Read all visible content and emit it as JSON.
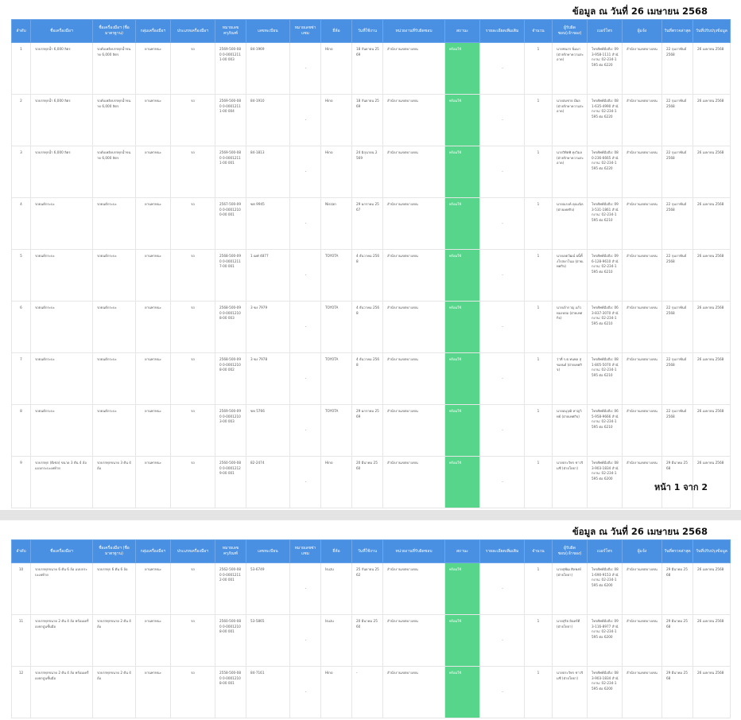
{
  "as_of": "ข้อมูล ณ วันที่ 26 เมษายน 2568",
  "page_indicator": "หน้า 1 จาก 2",
  "colors": {
    "header": "#4a90e2",
    "status_bg": "#57d58a",
    "page_gap": "#e4e4e4"
  },
  "columns": [
    "ลำดับ",
    "ชื่อเครื่องมือฯ",
    "ชื่อเครื่องมือฯ (ชื่อมาตรฐาน)",
    "กลุ่มเครื่องมือฯ",
    "ประเภทเครื่องมือฯ",
    "หมายเลขครุภัณฑ์",
    "เลขทะเบียน",
    "หมายเลขซ่าแซม",
    "ยี่ห้อ",
    "วันที่ใช้งาน",
    "หน่วยงานที่รับผิดชอบ",
    "สถานะ",
    "รายละเอียดเพิ่มเติม",
    "จำนวน",
    "ผู้รับผิดชอบ(เจ้าของ)",
    "เบอร์โทร",
    "ผู้แจ้ง",
    "วันที่ตรวจล่าสุด",
    "วันที่ปรับปรุงข้อมูล"
  ],
  "page1_rows": [
    {
      "no": "1",
      "name": "รถบรรทุกน้ำ 6,000 ลิตร",
      "std_name": "รถดับเพลิงบรรทุกน้ำขนาด 6,000 ลิตร",
      "group": "ยานพาหนะ",
      "type": "รถ",
      "asset_no": "2569-500-080 0-00012111-00 003",
      "reg_no": "84-1969",
      "chassis": "-",
      "brand": "Hino",
      "start_date": "18 กันยายน 2569",
      "agency": "สำนักงานเขตบางเขน",
      "status": "พร้อมใช้",
      "detail": "-",
      "qty": "1",
      "owner": "นายชนกร นิ่มมา (ฝ่ายรักษาความสะอาด)",
      "phone": "โทรศัพท์มือถือ: 093-958-1111 สำนักงาน: 02-234-1595 ต่อ 6220",
      "reporter": "สำนักงานเขตบางเขน",
      "last_check": "22 กุมภาพันธ์ 2568",
      "updated": "26 เมษายน 2568"
    },
    {
      "no": "2",
      "name": "รถบรรทุกน้ำ 6,000 ลิตร",
      "std_name": "รถดับเพลิงบรรทุกน้ำขนาด 6,000 ลิตร",
      "group": "ยานพาหนะ",
      "type": "รถ",
      "asset_no": "2569-500-080 0-00012111-00 004",
      "reg_no": "84-1910",
      "chassis": "-",
      "brand": "Hino",
      "start_date": "18 กันยายน 2569",
      "agency": "สำนักงานเขตบางเขน",
      "status": "พร้อมใช้",
      "detail": "-",
      "qty": "1",
      "owner": "นายสมชาย มีผล (ฝ่ายรักษาความสะอาด)",
      "phone": "โทรศัพท์มือถือ: 081-635-4990 สำนักงาน: 02-234-1595 ต่อ 6220",
      "reporter": "สำนักงานเขตบางเขน",
      "last_check": "22 กุมภาพันธ์ 2568",
      "updated": "26 เมษายน 2568"
    },
    {
      "no": "3",
      "name": "รถบรรทุกน้ำ 6,000 ลิตร",
      "std_name": "รถดับเพลิงบรรทุกน้ำขนาด 6,000 ลิตร",
      "group": "ยานพาหนะ",
      "type": "รถ",
      "asset_no": "2569-500-080 0-00012111-00 001",
      "reg_no": "84-1813",
      "chassis": "-",
      "brand": "Hino",
      "start_date": "24 มิถุนายน 2569",
      "agency": "สำนักงานเขตบางเขน",
      "status": "พร้อมใช้",
      "detail": "-",
      "qty": "1",
      "owner": "นายวิทิตพิ ทุงวิมล (ฝ่ายรักษาความสะอาด)",
      "phone": "โทรศัพท์มือถือ: 080-236-6665 สำนักงาน: 02-234-1595 ต่อ 6220",
      "reporter": "สำนักงานเขตบางเขน",
      "last_check": "22 กุมภาพันธ์ 2568",
      "updated": "26 เมษายน 2568"
    },
    {
      "no": "4",
      "name": "รถยนต์กระบะ",
      "std_name": "รถยนต์กระบะ",
      "group": "ยานพาหนะ",
      "type": "รถ",
      "asset_no": "2567-500-090 0-00012100-00 001",
      "reg_no": "ฆต 9945",
      "chassis": "-",
      "brand": "Nissan",
      "start_date": "29 มกราคม 2567",
      "agency": "สำนักงานเขตบางเขน",
      "status": "พร้อมใช้",
      "detail": "-",
      "qty": "1",
      "owner": "นายณรงค์ คุณเนิล (ฝ่ายเทศกิจ)",
      "phone": "โทรศัพท์มือถือ: 093-531-1861 สำนักงาน: 02-234-1595 ต่อ 6210",
      "reporter": "สำนักงานเขตบางเขน",
      "last_check": "22 กุมภาพันธ์ 2568",
      "updated": "26 เมษายน 2568"
    },
    {
      "no": "5",
      "name": "รถยนต์กระบะ",
      "std_name": "รถยนต์กระบะ",
      "group": "ยานพาหนะ",
      "type": "รถ",
      "asset_no": "2568-500-090 0-00012117-00 001",
      "reg_no": "1 ฒฬ 4877",
      "chassis": "-",
      "brand": "TOYOTA",
      "start_date": "4 ธันวาคม 2568",
      "agency": "สำนักงานเขตบางเขน",
      "status": "พร้อมใช้",
      "detail": "-",
      "qty": "1",
      "owner": "นายเจตวัฒน์ ผนิ้ทั้งโรสดาโนม (ฝ่ายเทศกิจ)",
      "phone": "โทรศัพท์มือถือ: 096-128-9610 สำนักงาน: 02-234-1595 ต่อ 6210",
      "reporter": "สำนักงานเขตบางเขน",
      "last_check": "22 กุมภาพันธ์ 2568",
      "updated": "26 เมษายน 2568"
    },
    {
      "no": "6",
      "name": "รถยนต์กระบะ",
      "std_name": "รถยนต์กระบะ",
      "group": "ยานพาหนะ",
      "type": "รถ",
      "asset_no": "2568-500-090 0-00012108-00 003",
      "reg_no": "3 ฆง 7979",
      "chassis": "-",
      "brand": "TOYOTA",
      "start_date": "4 ธันวาคม 2568",
      "agency": "สำนักงานเขตบางเขน",
      "status": "พร้อมใช้",
      "detail": "-",
      "qty": "1",
      "owner": "นายเจ้ากาญ แก้วทองหล่อ (ฝ่ายเทศกิจ)",
      "phone": "โทรศัพท์มือถือ: 063-837-3070 สำนักงาน: 02-234-1595 ต่อ 6210",
      "reporter": "สำนักงานเขตบางเขน",
      "last_check": "22 กุมภาพันธ์ 2568",
      "updated": "26 เมษายน 2568"
    },
    {
      "no": "7",
      "name": "รถยนต์กระบะ",
      "std_name": "รถยนต์กระบะ",
      "group": "ยานพาหนะ",
      "type": "รถ",
      "asset_no": "2568-500-090 0-00012108-00 002",
      "reg_no": "3 ฆง 7978",
      "chassis": "-",
      "brand": "TOYOTA",
      "start_date": "4 ธันวาคม 2568",
      "agency": "สำนักงานเขตบางเขน",
      "status": "พร้อมใช้",
      "detail": "-",
      "qty": "1",
      "owner": "ว่าที่ ร.ต.ทนพล สุขเยนด์ (ฝ่ายเทศกิจ)",
      "phone": "โทรศัพท์มือถือ: 081-805-5070 สำนักงาน: 02-234-1595 ต่อ 6210",
      "reporter": "สำนักงานเขตบางเขน",
      "last_check": "22 กุมภาพันธ์ 2568",
      "updated": "26 เมษายน 2568"
    },
    {
      "no": "8",
      "name": "รถยนต์กระบะ",
      "std_name": "รถยนต์กระบะ",
      "group": "ยานพาหนะ",
      "type": "รถ",
      "asset_no": "2569-500-090 0-00012103-00 003",
      "reg_no": "ฆห 5766",
      "chassis": "-",
      "brand": "TOYOTA",
      "start_date": "29 มกราคม 2569",
      "agency": "สำนักงานเขตบางเขน",
      "status": "พร้อมใช้",
      "detail": "-",
      "qty": "1",
      "owner": "นายอนุวุฒิ หาญวิทย์ (ฝ่ายเทศกิจ)",
      "phone": "โทรศัพท์มือถือ: 065-958-9666 สำนักงาน: 02-234-1595 ต่อ 6210",
      "reporter": "สำนักงานเขตบางเขน",
      "last_check": "22 กุมภาพันธ์ 2568",
      "updated": "26 เมษายน 2568"
    },
    {
      "no": "9",
      "name": "รถบรรทุก (ดีเซล) ขนาด 3 ตัน 4 ล้อ แบบกระบะเทท้าย",
      "std_name": "รถบรรทุกขนาด 3 ตัน 4 ล้อ",
      "group": "ยานพาหนะ",
      "type": "รถ",
      "asset_no": "2560-500-080 0-00012129-00 001",
      "reg_no": "82-2474",
      "chassis": "-",
      "brand": "Hino",
      "start_date": "20 มีนาคม 2560",
      "agency": "สำนักงานเขตบางเขน",
      "status": "พร้อมใช้",
      "detail": "-",
      "qty": "1",
      "owner": "นายประวิทร ชาวริมชี (ฝ่ายโยธา)",
      "phone": "โทรศัพท์มือถือ: 083-903-1834 สำนักงาน: 02-234-1595 ต่อ 6200",
      "reporter": "สำนักงานเขตบางเขน",
      "last_check": "29 มีนาคม 2568",
      "updated": "26 เมษายน 2568"
    }
  ],
  "page2_rows": [
    {
      "no": "10",
      "name": "รถบรรทุกขนาด 6 ตัน 6 ล้อ แบบกระบะเทท้าย",
      "std_name": "รถบรรทุก 6 ตัน 6 ล้อ",
      "group": "ยานพาหนะ",
      "type": "รถ",
      "asset_no": "2562-500-080 0-00012112-00 001",
      "reg_no": "53-6749",
      "chassis": "-",
      "brand": "Isuzu",
      "start_date": "25 กันยายน 2562",
      "agency": "สำนักงานเขตบางเขน",
      "status": "พร้อมใช้",
      "detail": "-",
      "qty": "1",
      "owner": "นายสุพัฒ ศิลพงษ์ (ฝ่ายโยธา)",
      "phone": "โทรศัพท์มือถือ: 081-690-9153 สำนักงาน: 02-234-1595 ต่อ 6200",
      "reporter": "สำนักงานเขตบางเขน",
      "last_check": "29 มีนาคม 2568",
      "updated": "26 เมษายน 2568"
    },
    {
      "no": "11",
      "name": "รถบรรทุกขนาด 2 ตัน 4 ล้อ พร้อมเครื่องยกปูนชั้นมือ",
      "std_name": "รถบรรทุกขนาด 2 ตัน 4 ล้อ",
      "group": "ยานพาหนะ",
      "type": "รถ",
      "asset_no": "2560-500-080 0-00012108-00 001",
      "reg_no": "53-5865",
      "chassis": "-",
      "brand": "Isuzu",
      "start_date": "20 มีนาคม 2560",
      "agency": "สำนักงานเขตบางเขน",
      "status": "พร้อมใช้",
      "detail": "-",
      "qty": "1",
      "owner": "นายสุริย อินทร์ดี (ฝ่ายโยธา)",
      "phone": "โทรศัพท์มือถือ: 093-116-8977 สำนักงาน: 02-234-1595 ต่อ 6200",
      "reporter": "สำนักงานเขตบางเขน",
      "last_check": "29 มีนาคม 2568",
      "updated": "26 เมษายน 2568"
    },
    {
      "no": "12",
      "name": "รถบรรทุกขนาด 2 ตัน 4 ล้อ พร้อมเครื่องยกปูนชั้นมือ",
      "std_name": "รถบรรทุกขนาด 2 ตัน 4 ล้อ",
      "group": "ยานพาหนะ",
      "type": "รถ",
      "asset_no": "2558-500-080 0-00012108-00 001",
      "reg_no": "84-7161",
      "chassis": "-",
      "brand": "Hino",
      "start_date": "-",
      "agency": "สำนักงานเขตบางเขน",
      "status": "พร้อมใช้",
      "detail": "-",
      "qty": "1",
      "owner": "นายประวิทร ชาวริมชี (ฝ่ายโยธา)",
      "phone": "โทรศัพท์มือถือ: 083-903-1834 สำนักงาน: 02-234-1595 ต่อ 6200",
      "reporter": "สำนักงานเขตบางเขน",
      "last_check": "29 มีนาคม 2568",
      "updated": "26 เมษายน 2568"
    }
  ]
}
